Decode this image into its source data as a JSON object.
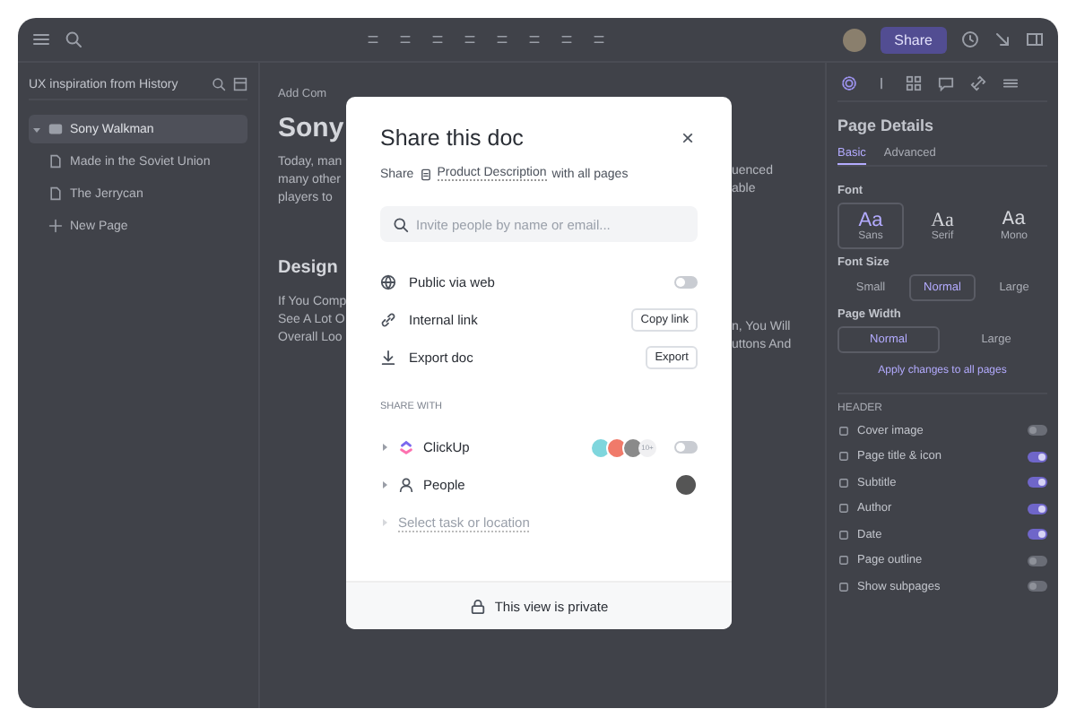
{
  "toolbar": {
    "share_button": "Share"
  },
  "sidebar": {
    "title": "UX inspiration from History",
    "items": [
      {
        "label": "Sony Walkman",
        "kind": "folder",
        "selected": true
      },
      {
        "label": "Made in the Soviet Union",
        "kind": "page",
        "selected": false
      },
      {
        "label": "The Jerrycan",
        "kind": "page",
        "selected": false
      }
    ],
    "new_page": "New Page"
  },
  "document": {
    "comment_hint": "Add Com",
    "title": "Sony",
    "paragraph_1": [
      {
        "start": "Today, man",
        "end": "uenced"
      },
      {
        "start": "many other",
        "end": "able"
      },
      {
        "start": "players to"
      }
    ],
    "heading": "Design",
    "paragraph_2": [
      {
        "start": "If You Comp",
        "end": "n, You Will"
      },
      {
        "start": "See A Lot O",
        "end": "uttons And"
      },
      {
        "start": "Overall Loo"
      }
    ]
  },
  "details_panel": {
    "title": "Page Details",
    "tabs": [
      {
        "label": "Basic",
        "selected": true
      },
      {
        "label": "Advanced",
        "selected": false
      }
    ],
    "font_label": "Font",
    "fonts": [
      {
        "sample": "Aa",
        "label": "Sans",
        "kind": "sans",
        "selected": true
      },
      {
        "sample": "Aa",
        "label": "Serif",
        "kind": "serif",
        "selected": false
      },
      {
        "sample": "Aa",
        "label": "Mono",
        "kind": "mono",
        "selected": false
      }
    ],
    "font_size_label": "Font Size",
    "font_sizes": [
      {
        "label": "Small",
        "selected": false
      },
      {
        "label": "Normal",
        "selected": true
      },
      {
        "label": "Large",
        "selected": false
      }
    ],
    "page_width_label": "Page Width",
    "page_widths": [
      {
        "label": "Normal",
        "selected": true
      },
      {
        "label": "Large",
        "selected": false
      }
    ],
    "apply_all": "Apply changes to all pages",
    "header_label": "HEADER",
    "header_options": [
      {
        "label": "Cover image",
        "on": false
      },
      {
        "label": "Page title & icon",
        "on": true
      },
      {
        "label": "Subtitle",
        "on": true
      },
      {
        "label": "Author",
        "on": true
      },
      {
        "label": "Date",
        "on": true
      },
      {
        "label": "Page outline",
        "on": false
      },
      {
        "label": "Show subpages",
        "on": false
      }
    ]
  },
  "share_dialog": {
    "title": "Share this doc",
    "close": "×",
    "subtitle_start": "Share",
    "doc_name": "Product Description",
    "subtitle_end": "with all pages",
    "search": {
      "placeholder": "Invite people by name or email..."
    },
    "options": [
      {
        "label": "Public via web",
        "kind": "toggle",
        "on": false
      },
      {
        "label": "Internal link",
        "kind": "button",
        "button": "Copy link"
      },
      {
        "label": "Export doc",
        "kind": "button",
        "button": "Export"
      }
    ],
    "share_with_label": "SHARE WITH",
    "share_with": [
      {
        "label": "ClickUp",
        "kind": "workspace",
        "avatar_count": "10+",
        "on": false
      },
      {
        "label": "People",
        "kind": "people"
      }
    ],
    "location_placeholder": "Select task or location",
    "footer": "This view is private"
  }
}
